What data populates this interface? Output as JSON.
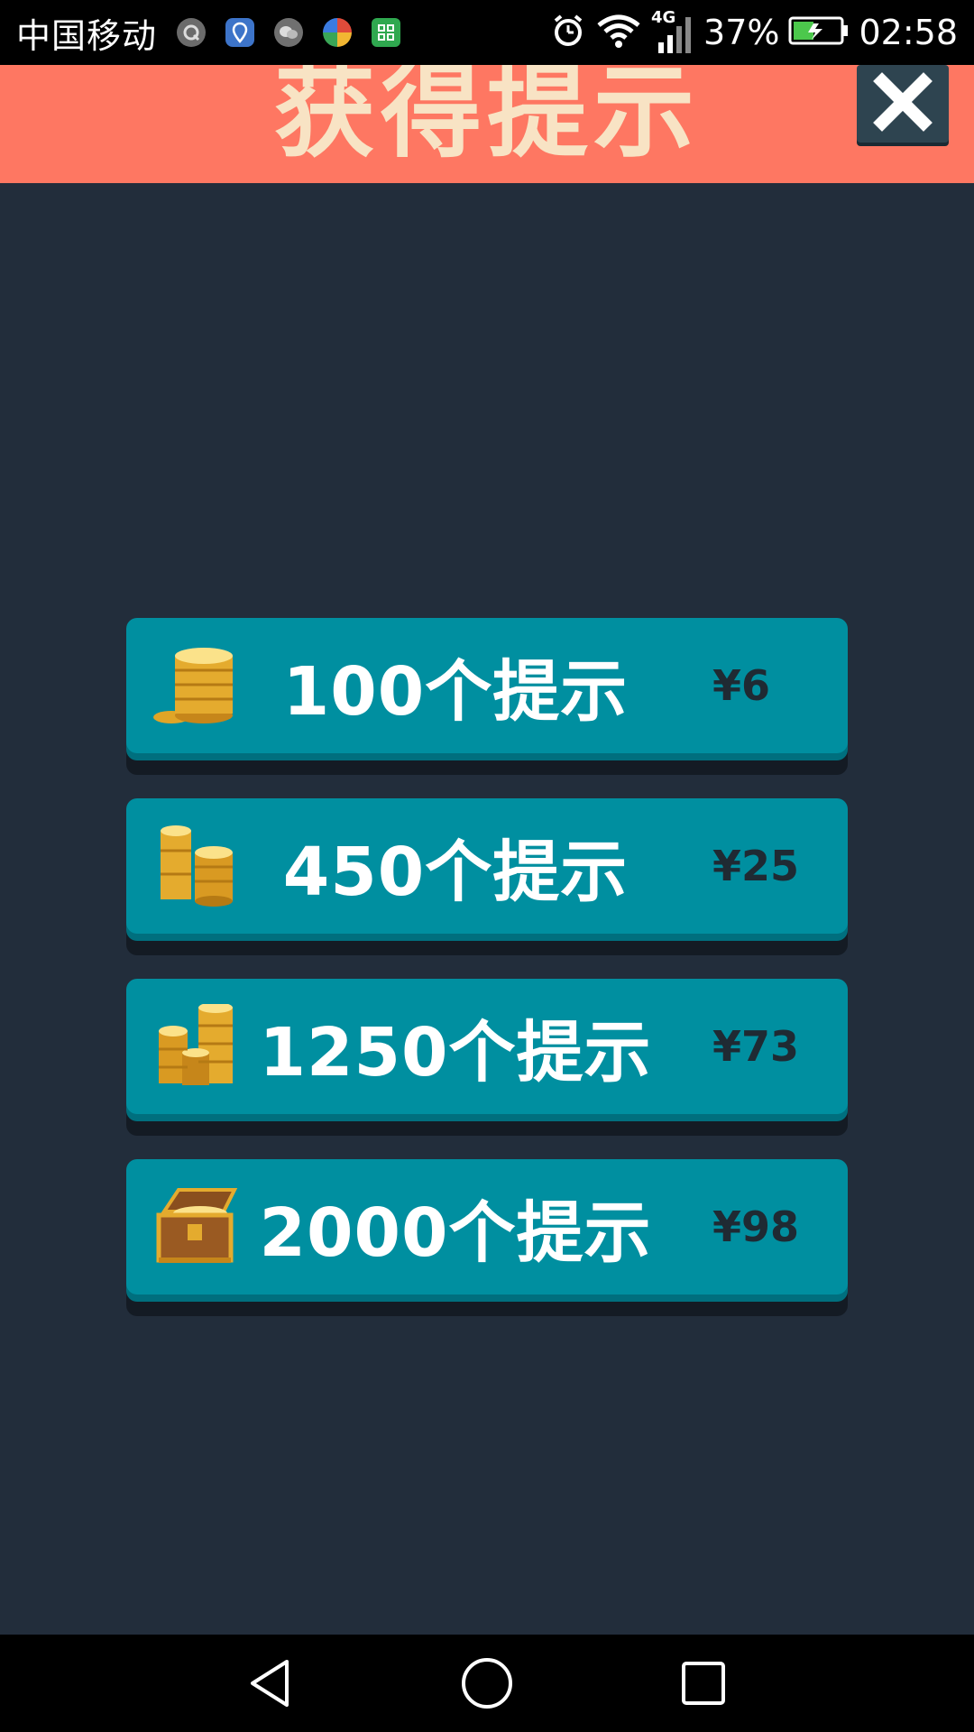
{
  "status_bar": {
    "carrier": "中国移动",
    "network": "4G",
    "battery": "37%",
    "time": "02:58",
    "notification_icons": [
      "q-app-icon",
      "location-app-icon",
      "wechat-icon",
      "browser-icon",
      "app-grid-icon"
    ],
    "system_icons": [
      "alarm-icon",
      "wifi-icon",
      "signal-icon",
      "battery-icon"
    ]
  },
  "header": {
    "title": "获得提示",
    "close_icon": "close-icon",
    "background_color": "#fe7762",
    "title_color": "#f8e3c4"
  },
  "packages": [
    {
      "label": "100个提示",
      "price": "¥6",
      "icon": "coin-stack-small-icon"
    },
    {
      "label": "450个提示",
      "price": "¥25",
      "icon": "coin-stack-medium-icon"
    },
    {
      "label": "1250个提示",
      "price": "¥73",
      "icon": "coin-stack-large-icon"
    },
    {
      "label": "2000个提示",
      "price": "¥98",
      "icon": "treasure-chest-icon"
    }
  ],
  "colors": {
    "background": "#222d3b",
    "button": "#008fa0",
    "button_edge": "#006f7e"
  },
  "nav_bar": {
    "icons": [
      "back-icon",
      "home-icon",
      "recents-icon"
    ]
  }
}
